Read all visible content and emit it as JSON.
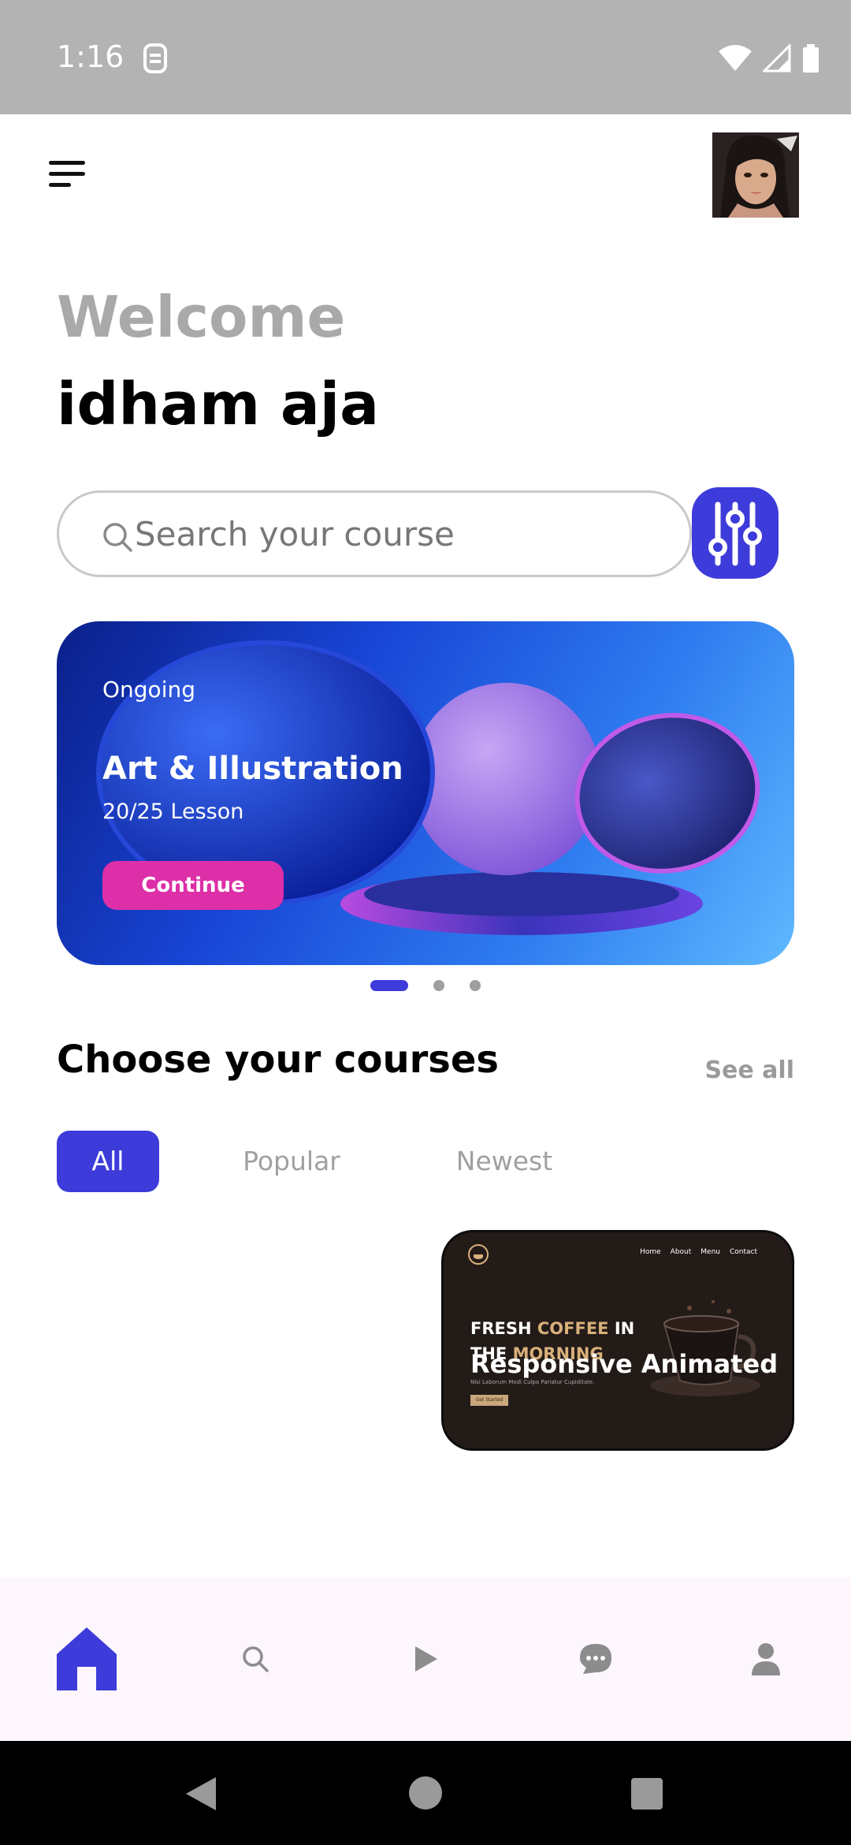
{
  "status_bar": {
    "time": "1:16",
    "icons": [
      "sim-icon",
      "wifi-icon",
      "signal-icon",
      "battery-icon"
    ]
  },
  "header": {
    "menu_icon": "hamburger-menu-icon",
    "greeting": "Welcome",
    "username": "idham aja"
  },
  "search": {
    "placeholder": "Search your course",
    "value": "",
    "filter_icon": "sliders-icon"
  },
  "banner": {
    "status": "Ongoing",
    "title": "Art & Illustration",
    "lessons": "20/25 Lesson",
    "button_label": "Continue",
    "pages": 3,
    "active_page": 0
  },
  "courses": {
    "section_title": "Choose your courses",
    "see_all_label": "See all",
    "filters": [
      {
        "label": "All",
        "active": true
      },
      {
        "label": "Popular",
        "active": false
      },
      {
        "label": "Newest",
        "active": false
      }
    ],
    "items": [
      {
        "title": "Responsive Animated",
        "thumb_nav": [
          "Home",
          "About",
          "Menu",
          "Contact"
        ],
        "thumb_heading_1": "FRESH",
        "thumb_heading_accent": "COFFEE",
        "thumb_heading_2": "IN",
        "thumb_heading_3": "THE",
        "thumb_heading_accent_2": "MORNING",
        "thumb_sub": "Nisi Laborum Modi Culpa Pariatur Cupiditate.",
        "thumb_button": "Get Started"
      }
    ]
  },
  "bottom_nav": {
    "items": [
      {
        "name": "home",
        "icon": "home-icon",
        "active": true
      },
      {
        "name": "search",
        "icon": "search-icon",
        "active": false
      },
      {
        "name": "play",
        "icon": "play-icon",
        "active": false
      },
      {
        "name": "chat",
        "icon": "chat-icon",
        "active": false
      },
      {
        "name": "profile",
        "icon": "person-icon",
        "active": false
      }
    ]
  },
  "colors": {
    "accent": "#3d3bd9",
    "continue_button": "#dd2fa8",
    "status_bar": "#b3b3b3",
    "bottom_nav_bg": "#fdf6fc"
  }
}
